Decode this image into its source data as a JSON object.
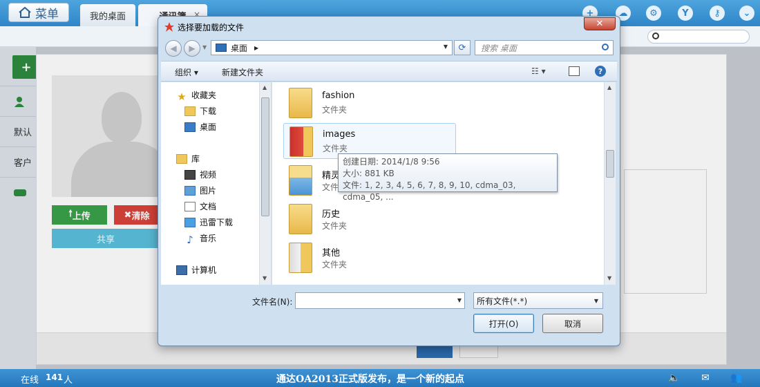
{
  "topbar": {
    "menu_label": "菜单",
    "tabs": [
      {
        "label": "我的桌面"
      },
      {
        "label": "通讯簿",
        "close": "×"
      }
    ],
    "icons": [
      "add-icon",
      "cloud-icon",
      "gear-icon",
      "shirt-icon",
      "key-icon",
      "chevron-down-icon"
    ]
  },
  "panel": {
    "upload_label": "上传",
    "clear_label": "清除",
    "share_label": "共享",
    "sidebar_rows": [
      "默认",
      "客户"
    ]
  },
  "dialog": {
    "title": "选择要加载的文件",
    "close_label": "✕",
    "address": {
      "location": "桌面"
    },
    "search": {
      "placeholder": "搜索 桌面"
    },
    "commands": {
      "organize": "组织 ▾",
      "new_folder": "新建文件夹"
    },
    "nav": {
      "favorites": "收藏夹",
      "downloads": "下载",
      "desktop": "桌面",
      "libraries": "库",
      "videos": "视频",
      "pictures": "图片",
      "documents": "文档",
      "thunder": "迅雷下载",
      "music": "音乐",
      "computer": "计算机"
    },
    "files": [
      {
        "name": "fashion",
        "type": "文件夹"
      },
      {
        "name": "images",
        "type": "文件夹"
      },
      {
        "name": "精灵",
        "type": "文件夹"
      },
      {
        "name": "历史",
        "type": "文件夹"
      },
      {
        "name": "其他",
        "type": "文件夹"
      }
    ],
    "tooltip": {
      "created": "创建日期: 2014/1/8 9:56",
      "size": "大小: 881 KB",
      "files": "文件: 1, 2, 3, 4, 5, 6, 7, 8, 9, 10, cdma_03, cdma_05, ..."
    },
    "filename_label": "文件名(N):",
    "filename_value": "",
    "filter": "所有文件(*.*)",
    "open_label": "打开(O)",
    "cancel_label": "取消"
  },
  "status": {
    "online_label": "在线",
    "online_count": "141",
    "person_label": "人",
    "announcement": "通达OA2013正式版发布，是一个新的起点"
  },
  "colors": {
    "topbar": "#3a93d5",
    "upload": "#3aa24a",
    "clear": "#d9433a",
    "share": "#5bc0de"
  }
}
